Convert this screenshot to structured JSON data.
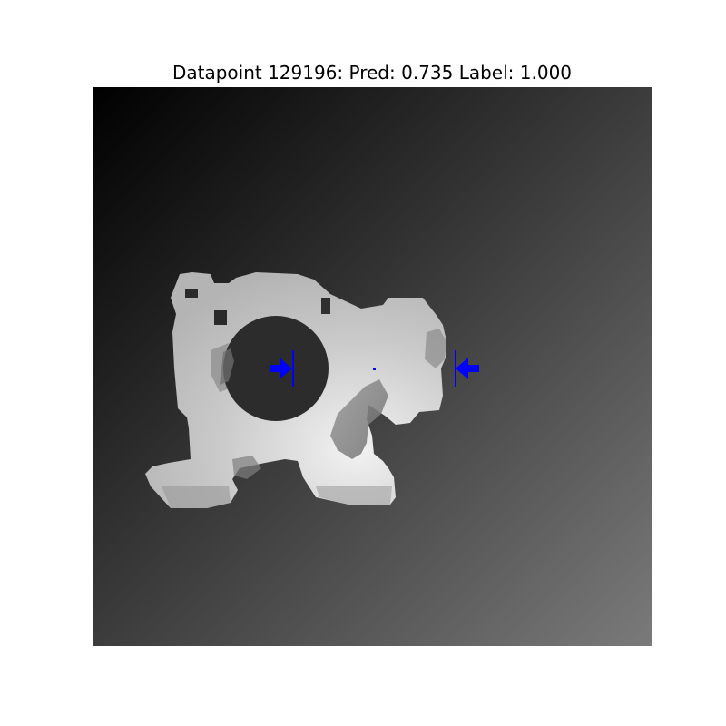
{
  "figure": {
    "title": "Datapoint 129196: Pred: 0.735 Label: 1.000",
    "datapoint_id": 129196,
    "prediction": 0.735,
    "label": 1.0
  },
  "image": {
    "kind": "depth-image",
    "subject": "grayscale depth image of a light object with a circular hole on a dark gradient background",
    "background_gradient": [
      "#000000",
      "#7a7a7a"
    ],
    "object_color": "#d2d2d2"
  },
  "grasp": {
    "marker_color": "#0000ff",
    "markers": [
      "left-jaw-arrow-icon",
      "right-jaw-arrow-icon",
      "grasp-center-dot"
    ]
  }
}
